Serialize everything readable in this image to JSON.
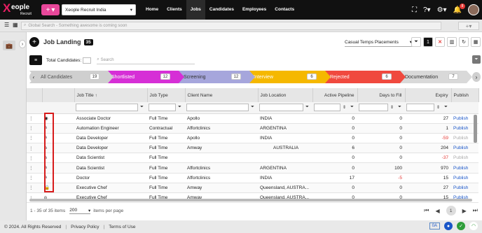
{
  "brand": {
    "mark": "X",
    "word": "eople",
    "sub": "Recruit"
  },
  "header": {
    "plus_label": "+",
    "plus_caret": "▾",
    "company": "Xeople Recruit India",
    "notif_count": "8"
  },
  "nav": [
    "Home",
    "Clients",
    "Jobs",
    "Candidates",
    "Employees",
    "Contacts"
  ],
  "search": {
    "placeholder": "Global Search - Something awesome is coming soon",
    "quick_add": "+"
  },
  "page": {
    "title": "Job Landing",
    "count": "35",
    "view": "Casual Temps Placements",
    "filter_count": "1"
  },
  "filters": {
    "total_label": "Total Candidates:",
    "search_placeholder": "Search"
  },
  "pipeline": [
    {
      "label": "All Candidates",
      "count": "19",
      "color": "#cfcfcf",
      "text": "#555"
    },
    {
      "label": "Shortlisted",
      "count": "12",
      "color": "#d62fd6",
      "text": "#fff"
    },
    {
      "label": "Screening",
      "count": "12",
      "color": "#a6a6dc",
      "text": "#333"
    },
    {
      "label": "Interview",
      "count": "6",
      "color": "#f5b800",
      "text": "#fff"
    },
    {
      "label": "Rejected",
      "count": "6",
      "color": "#f0493e",
      "text": "#fff"
    },
    {
      "label": "Documentation",
      "count": "7",
      "color": "#d9d9d9",
      "text": "#333"
    }
  ],
  "columns": [
    "",
    "",
    "Job Title ↑",
    "Job Type",
    "Client Name",
    "Job Location",
    "Active Pipeline",
    "Days to Fill",
    "Expiry",
    "Publish"
  ],
  "rows": [
    {
      "icon": "user-circle-icon",
      "title": "Associate Doctor",
      "type": "Full Time",
      "client": "Apollo",
      "location": "INDIA",
      "pipeline": "0",
      "days": "0",
      "expiry": "27",
      "neg": false,
      "publish": "Publish",
      "pub_on": true
    },
    {
      "icon": "person-outline-icon",
      "title": "Automation Engineer",
      "type": "Contractual",
      "client": "Affortclinics",
      "location": "ARGENTINA",
      "pipeline": "0",
      "days": "0",
      "expiry": "1",
      "neg": false,
      "publish": "Publish",
      "pub_on": true
    },
    {
      "icon": "person-outline-icon",
      "title": "Data Developer",
      "type": "Full Time",
      "client": "Apollo",
      "location": "INDIA",
      "pipeline": "0",
      "days": "0",
      "expiry": "-59",
      "neg": true,
      "publish": "Publish",
      "pub_on": false
    },
    {
      "icon": "person-outline-icon",
      "title": "Data Developer",
      "type": "Full Time",
      "client": "Amway",
      "location": "AUSTRALIA",
      "pipeline": "6",
      "days": "0",
      "expiry": "204",
      "neg": false,
      "publish": "Publish",
      "pub_on": true
    },
    {
      "icon": "person-outline-icon",
      "title": "Data Scientist",
      "type": "Full Time",
      "client": "",
      "location": "",
      "pipeline": "0",
      "days": "0",
      "expiry": "-37",
      "neg": true,
      "publish": "Publish",
      "pub_on": false
    },
    {
      "icon": "person-outline-icon",
      "title": "Data Scientist",
      "type": "Full Time",
      "client": "Affortclinics",
      "location": "ARGENTINA",
      "pipeline": "0",
      "days": "100",
      "expiry": "970",
      "neg": false,
      "publish": "Publish",
      "pub_on": true
    },
    {
      "icon": "person-outline-icon",
      "title": "Doctor",
      "type": "Full Time",
      "client": "Affortclinics",
      "location": "INDIA",
      "pipeline": "17",
      "days": "-5",
      "expiry": "15",
      "neg": false,
      "daysneg": true,
      "publish": "Publish",
      "pub_on": true
    },
    {
      "icon": "lock-icon",
      "title": "Executive Chef",
      "type": "Full Time",
      "client": "Amway",
      "location": "Queensland, AUSTRA...",
      "pipeline": "0",
      "days": "0",
      "expiry": "27",
      "neg": false,
      "publish": "Publish",
      "pub_on": true
    },
    {
      "icon": "person-outline-icon",
      "title": "Executive Chef",
      "type": "Full Time",
      "client": "Amway",
      "location": "Queensland, AUSTRA...",
      "pipeline": "0",
      "days": "0",
      "expiry": "15",
      "neg": false,
      "publish": "Publish",
      "pub_on": true
    }
  ],
  "pager": {
    "info": "1 - 35 of 35 items",
    "size": "200",
    "ipp": "items per page",
    "page": "1"
  },
  "footer": {
    "copyright": "© 2024. All Rights Reserved",
    "privacy": "Privacy Policy",
    "terms": "Terms of Use",
    "lang": "0A"
  }
}
